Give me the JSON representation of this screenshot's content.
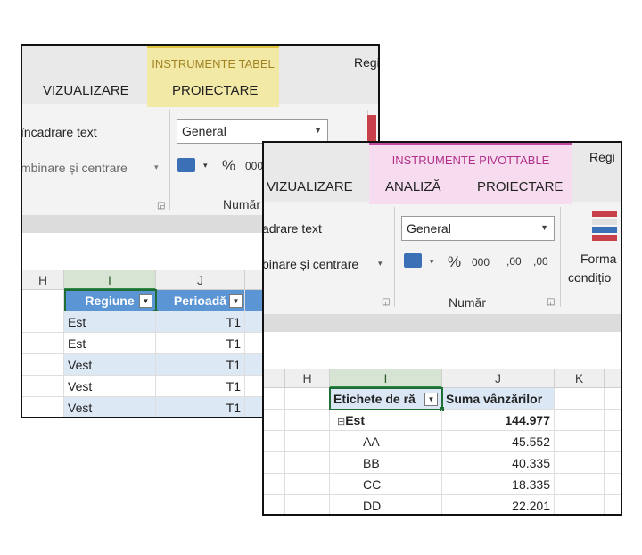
{
  "back_window": {
    "context_tab_group": "INSTRUMENTE TABEL",
    "tabs": [
      "VIZUALIZARE",
      "PROIECTARE"
    ],
    "right_fragment": "Regi",
    "wrap_text": "încadrare text",
    "merge_center": "mbinare și centrare",
    "number_format": "General",
    "number_group": "Număr",
    "percent_symbol": "%",
    "comma_symbol": "000",
    "column_headers": [
      "H",
      "I",
      "J"
    ],
    "table_headers": [
      "Regiune",
      "Perioadă"
    ],
    "rows": [
      {
        "region": "Est",
        "period": "T1"
      },
      {
        "region": "Est",
        "period": "T1"
      },
      {
        "region": "Vest",
        "period": "T1"
      },
      {
        "region": "Vest",
        "period": "T1"
      },
      {
        "region": "Vest",
        "period": "T1"
      }
    ]
  },
  "front_window": {
    "context_tab_group": "INSTRUMENTE PIVOTTABLE",
    "tabs": [
      "VIZUALIZARE",
      "ANALIZĂ",
      "PROIECTARE"
    ],
    "right_fragment": "Regi",
    "wrap_text": "adrare text",
    "merge_center": "binare și centrare",
    "number_format": "General",
    "number_group": "Număr",
    "percent_symbol": "%",
    "comma_symbol": "000",
    "increase_decimal": ",00",
    "decrease_decimal": ",00",
    "format_conditional": [
      "Forma",
      "condițio"
    ],
    "column_headers": [
      "H",
      "I",
      "J",
      "K"
    ],
    "pivot_headers": [
      "Etichete de ră",
      "Suma vânzărilor"
    ],
    "group_row": {
      "label": "Est",
      "value": "144.977"
    },
    "rows": [
      {
        "label": "AA",
        "value": "45.552"
      },
      {
        "label": "BB",
        "value": "40.335"
      },
      {
        "label": "CC",
        "value": "18.335"
      },
      {
        "label": "DD",
        "value": "22.201"
      }
    ]
  },
  "colors": {
    "table_tools_accent": "#f3e9a6",
    "pivot_tools_accent": "#f6dcee",
    "pivot_tools_text": "#b0308a",
    "table_header_blue": "#5b95d4",
    "selection_green": "#1e6e36"
  }
}
